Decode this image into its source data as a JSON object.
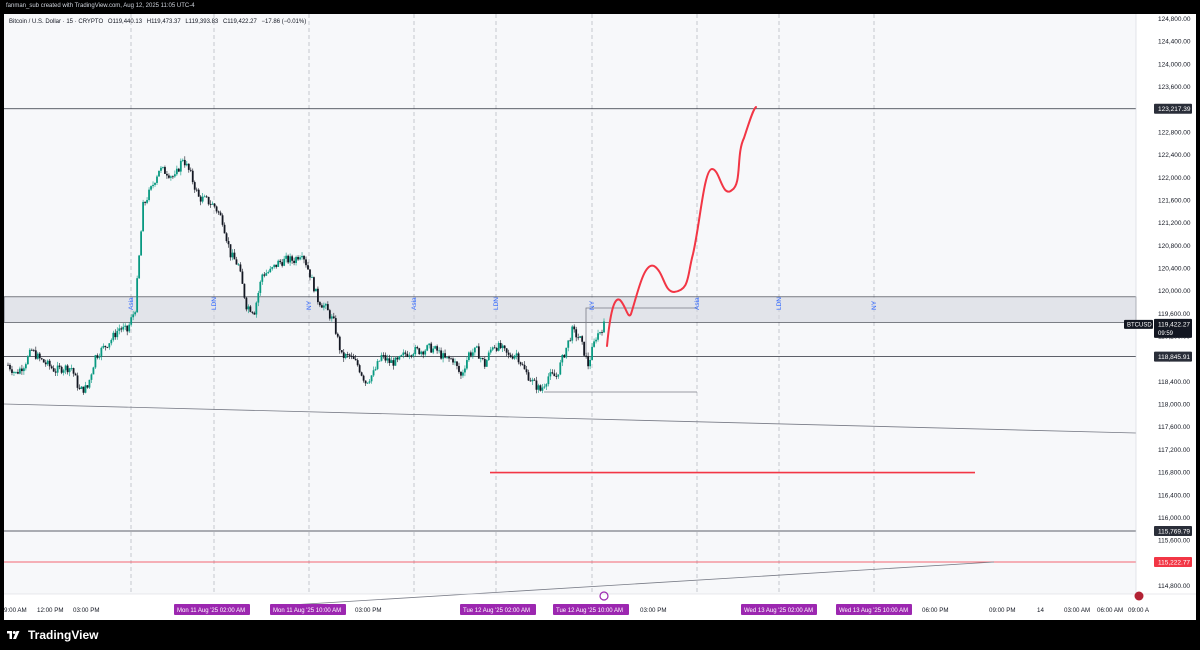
{
  "header": {
    "text": "fanman_sub created with TradingView.com, Aug 12, 2025 11:05 UTC-4"
  },
  "legend": {
    "symbol": "Bitcoin / U.S. Dollar · 15 · CRYPTO",
    "open": "O119,440.13",
    "high": "H119,473.37",
    "low": "L119,393.83",
    "close": "C119,422.27",
    "change": "−17.86 (−0.01%)"
  },
  "price_badges": {
    "upper": "123,217.39",
    "current_symbol": "BTCUSD",
    "current_price": "119,422.27",
    "countdown": "09:59",
    "support": "118,845.91",
    "low1": "115,769.79",
    "low2": "115,222.77"
  },
  "time_axis": {
    "labels": [
      "9:00 AM",
      "12:00 PM",
      "03:00 PM",
      "03:00 PM",
      "03:00 PM",
      "06:00 PM",
      "09:00 PM",
      "14",
      "03:00 AM",
      "06:00 AM",
      "09:00 A"
    ],
    "highlights": [
      "Mon 11 Aug '25   02:00 AM",
      "Mon 11 Aug '25   10:00 AM",
      "Tue 12 Aug '25   02:00 AM",
      "Tue 12 Aug '25   10:00 AM",
      "Wed 13 Aug '25   02:00 AM",
      "Wed 13 Aug '25   10:00 AM"
    ]
  },
  "footer": {
    "brand": "TradingView"
  },
  "colors": {
    "up": "#089981",
    "down": "#131722",
    "drawing": "#f23645",
    "session": "#2962ff",
    "zone": "#d1d4dc",
    "badge_dark": "#2a2e39",
    "badge_red": "#f23645",
    "time_highlight": "#9c27b0"
  },
  "chart_data": {
    "type": "candlestick",
    "y_axis_ticks": [
      124800,
      124400,
      124000,
      123600,
      123200,
      122800,
      122400,
      122000,
      121600,
      121200,
      120800,
      120400,
      120000,
      119600,
      119200,
      118800,
      118400,
      118000,
      117600,
      117200,
      116800,
      116400,
      116000,
      115600,
      115200,
      114800
    ],
    "ylim": [
      114600,
      125000
    ],
    "horizontal_levels": [
      123217.39,
      118845.91,
      115769.79,
      115222.77
    ],
    "red_level": 116800,
    "zone": [
      119450,
      119900
    ],
    "session_labels": [
      "Asia",
      "LDN",
      "NY",
      "Asia",
      "LDN",
      "NY",
      "Asia",
      "LDN",
      "NY"
    ],
    "close_path": [
      118700,
      118550,
      118700,
      118950,
      118800,
      118700,
      118600,
      118650,
      118650,
      118250,
      118300,
      118850,
      119000,
      119150,
      119350,
      119300,
      119700,
      121500,
      121800,
      122150,
      122100,
      122000,
      122350,
      122050,
      121650,
      121600,
      121500,
      121250,
      120650,
      120450,
      119750,
      119650,
      120300,
      120350,
      120500,
      120550,
      120550,
      120700,
      120300,
      119850,
      119700,
      119450,
      118850,
      118850,
      118700,
      118400,
      118550,
      118850,
      118750,
      118750,
      118900,
      118950,
      118950,
      119000,
      118950,
      118800,
      118800,
      118500,
      118900,
      118950,
      118700,
      119050,
      119000,
      118850,
      118900,
      118600,
      118400,
      118250,
      118500,
      118500,
      118900,
      119300,
      119150,
      118700,
      119200,
      119400
    ]
  }
}
